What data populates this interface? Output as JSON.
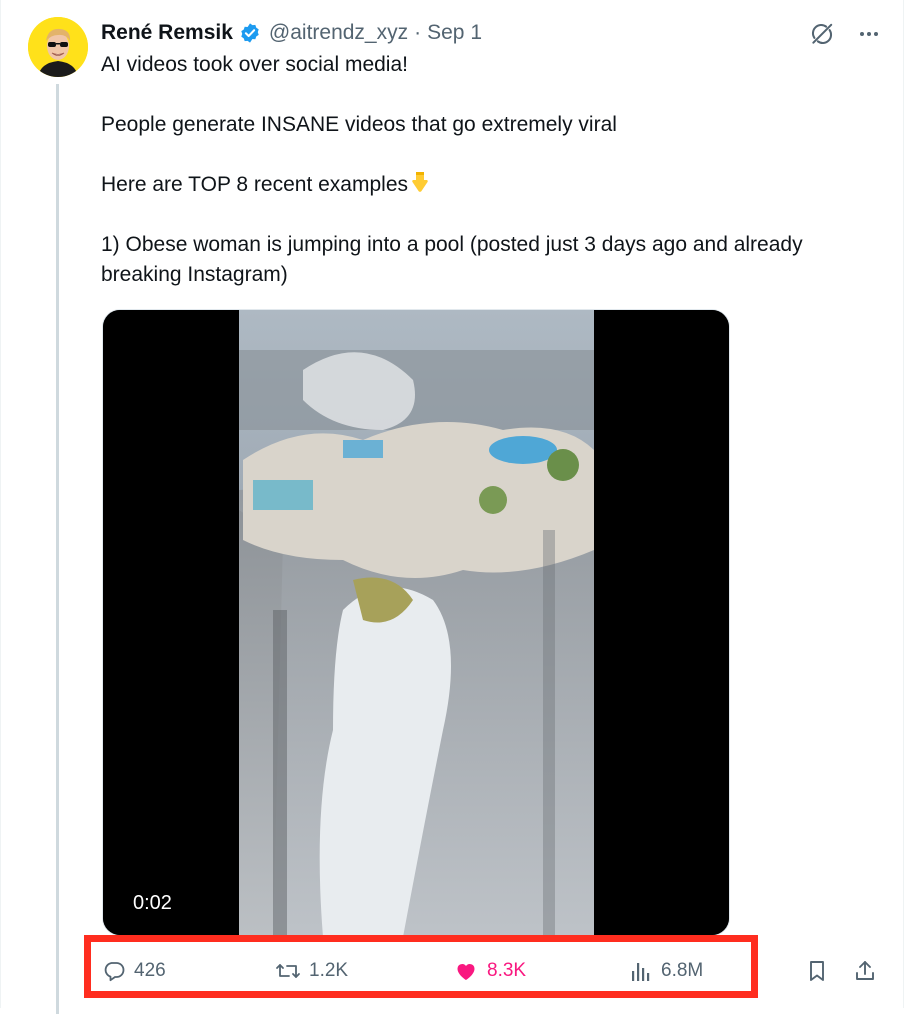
{
  "author": {
    "name": "René Remsik",
    "handle": "@aitrendz_xyz",
    "separator": "·",
    "date": "Sep 1",
    "avatar_bg": "#ffe11a"
  },
  "post": {
    "paragraphs": [
      "AI videos took over social media!",
      "People generate INSANE videos that go extremely viral",
      "Here are TOP 8 recent examples",
      "1) Obese woman is jumping into a pool (posted just 3 days ago and already breaking Instagram)"
    ],
    "emoji_icon": "pointing-down-emoji"
  },
  "media": {
    "timestamp": "0:02",
    "description_icon": "video-thumbnail"
  },
  "actions": {
    "replies": "426",
    "reposts": "1.2K",
    "likes": "8.3K",
    "views": "6.8M"
  },
  "icons": {
    "verified": "verified-badge-icon",
    "grok": "grok-icon",
    "more": "more-icon",
    "reply": "reply-icon",
    "repost": "repost-icon",
    "like": "heart-icon",
    "views": "views-icon",
    "bookmark": "bookmark-icon",
    "share": "share-icon"
  },
  "colors": {
    "verified": "#1d9bf0",
    "like": "#f91880",
    "muted": "#536471",
    "highlight": "#ff2d1f"
  }
}
